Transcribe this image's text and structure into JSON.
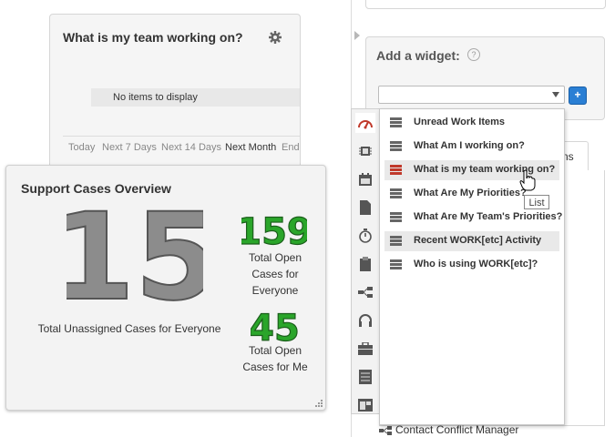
{
  "team_widget": {
    "title": "What is my team working on?",
    "empty_text": "No items to display",
    "ranges": [
      "Today",
      "Next 7 Days",
      "Next 14 Days",
      "Next Month",
      "End"
    ],
    "active_range": "Next Month"
  },
  "support_widget": {
    "title": "Support Cases Overview",
    "unassigned_count": "15",
    "unassigned_caption": "Total Unassigned Cases for Everyone",
    "open_everyone_count": "159",
    "open_everyone_caption": "Total Open Cases for Everyone",
    "open_me_count": "45",
    "open_me_caption": "Total Open Cases for Me",
    "colors": {
      "big_number": "#8c8c8c",
      "green_number": "#2aa52a"
    }
  },
  "add_widget": {
    "title": "Add a widget:",
    "help_label": "?",
    "select_value": "",
    "add_button_label": "+"
  },
  "background_tab": {
    "label": "ns"
  },
  "background_item": {
    "label": "Contact Conflict Manager",
    "icon": "hierarchy-icon"
  },
  "icon_strip": [
    {
      "icon": "gauge-icon",
      "active": true
    },
    {
      "icon": "chip-icon"
    },
    {
      "icon": "calendar-icon"
    },
    {
      "icon": "document-icon"
    },
    {
      "icon": "stopwatch-icon"
    },
    {
      "icon": "clipboard-icon"
    },
    {
      "icon": "hierarchy-icon"
    },
    {
      "icon": "headset-icon"
    },
    {
      "icon": "briefcase-icon"
    },
    {
      "icon": "ledger-icon"
    },
    {
      "icon": "window-icon"
    }
  ],
  "menu": {
    "items": [
      {
        "label": "Unread Work Items"
      },
      {
        "label": "What Am I working on?"
      },
      {
        "label": "What is my team working on?",
        "hover": true
      },
      {
        "label": "What Are My Priorities?"
      },
      {
        "label": "What Are My Team's Priorities?"
      },
      {
        "label": "Recent WORK[etc] Activity",
        "selected": true
      },
      {
        "label": "Who is using WORK[etc]?"
      }
    ],
    "tooltip": "List",
    "colors": {
      "list_icon": "#666666",
      "list_icon_hover": "#c0392b"
    }
  }
}
